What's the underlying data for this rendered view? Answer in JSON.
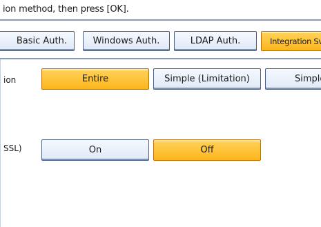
{
  "instruction": "ion method, then press [OK].",
  "auth_tabs": [
    {
      "label": "Basic Auth.",
      "selected": false
    },
    {
      "label": "Windows Auth.",
      "selected": false
    },
    {
      "label": "LDAP Auth.",
      "selected": false
    },
    {
      "label": "Integration Svr.",
      "selected": true
    }
  ],
  "row1": {
    "label": "ion",
    "options": [
      {
        "label": "Entire",
        "selected": true
      },
      {
        "label": "Simple (Limitation)",
        "selected": false
      },
      {
        "label": "Simple",
        "selected": false
      }
    ]
  },
  "row2": {
    "label": "SSL)",
    "options": [
      {
        "label": "On",
        "selected": false
      },
      {
        "label": "Off",
        "selected": true
      }
    ]
  },
  "colors": {
    "selected": "#fcb61c",
    "normal": "#dfe9f7",
    "border": "#4a5f82"
  }
}
